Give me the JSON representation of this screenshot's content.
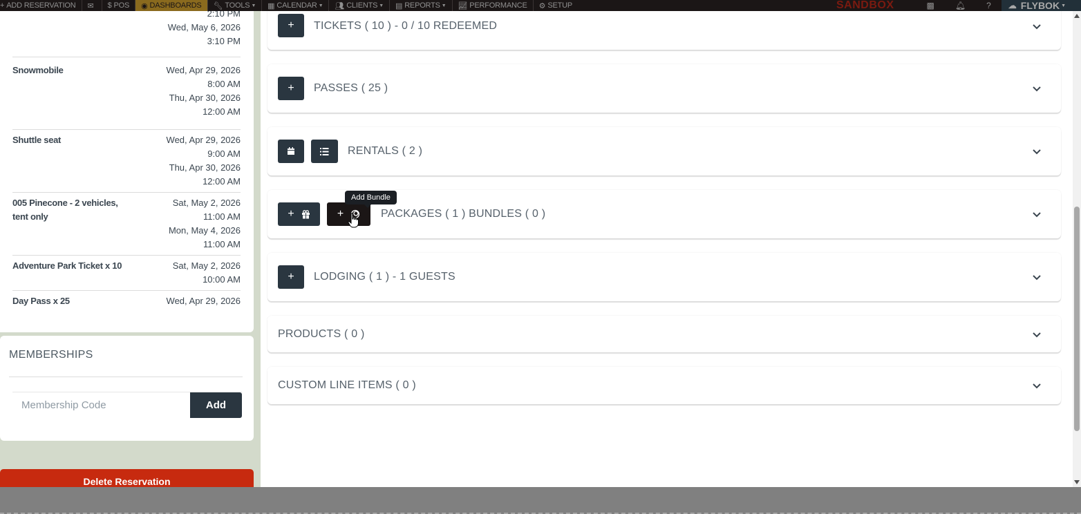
{
  "topnav": {
    "items": [
      {
        "label": "ADD RESERVATION",
        "icon": "plus-icon"
      },
      {
        "label": "",
        "icon": "envelope-icon"
      },
      {
        "label": "POS",
        "icon": "dollar-icon"
      },
      {
        "label": "DASHBOARDS",
        "icon": "dashboard-icon"
      },
      {
        "label": "TOOLS",
        "icon": "wrench-icon"
      },
      {
        "label": "CALENDAR",
        "icon": "calendar-icon"
      },
      {
        "label": "CLIENTS",
        "icon": "users-icon"
      },
      {
        "label": "REPORTS",
        "icon": "file-icon"
      },
      {
        "label": "PERFORMANCE",
        "icon": "chart-line-icon"
      },
      {
        "label": "SETUP",
        "icon": "gear-icon"
      }
    ],
    "sandbox_label": "SANDBOX",
    "brand_label": "FLYBOK"
  },
  "reservation_items": [
    {
      "name": "",
      "dates": [
        "2:10 PM",
        "Wed, May 6, 2026",
        "3:10 PM"
      ]
    },
    {
      "name": "Snowmobile",
      "dates": [
        "Wed, Apr 29, 2026",
        "8:00 AM",
        "Thu, Apr 30, 2026",
        "12:00 AM"
      ]
    },
    {
      "name": "Shuttle seat",
      "dates": [
        "Wed, Apr 29, 2026",
        "9:00 AM",
        "Thu, Apr 30, 2026",
        "12:00 AM"
      ]
    },
    {
      "name": "005 Pinecone - 2 vehicles, tent only",
      "dates": [
        "Sat, May 2, 2026",
        "11:00 AM",
        "Mon, May 4, 2026",
        "11:00 AM"
      ]
    },
    {
      "name": "Adventure Park Ticket x 10",
      "dates": [
        "Sat, May 2, 2026",
        "10:00 AM"
      ]
    },
    {
      "name": "Day Pass x 25",
      "dates": [
        "Wed, Apr 29, 2026"
      ]
    }
  ],
  "memberships": {
    "title": "MEMBERSHIPS",
    "input_placeholder": "Membership Code",
    "add_label": "Add"
  },
  "delete_label": "Delete Reservation",
  "sections": {
    "tickets": "TICKETS ( 10 ) - 0 / 10 REDEEMED",
    "passes": "PASSES ( 25 )",
    "rentals": "RENTALS ( 2 )",
    "packages": "PACKAGES ( 1 ) BUNDLES ( 0 )",
    "lodging": "LODGING ( 1 ) - 1 GUESTS",
    "products": "PRODUCTS ( 0 )",
    "custom": "CUSTOM LINE ITEMS ( 0 )"
  },
  "tooltip": "Add Bundle",
  "colors": {
    "button_dark": "#2a3640",
    "delete": "#c72a0f",
    "nav_active": "#8a6a1e",
    "left_bg": "#d3dacb"
  }
}
